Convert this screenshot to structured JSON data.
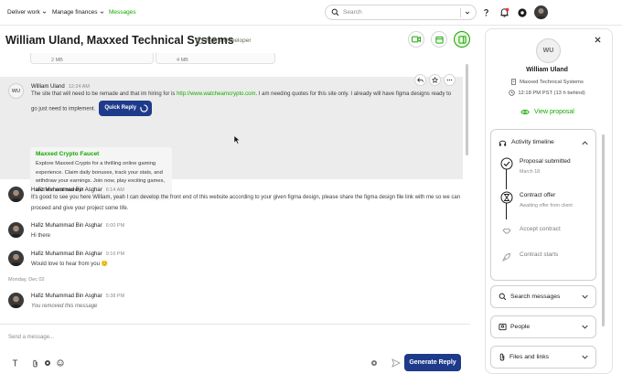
{
  "nav": {
    "items": [
      {
        "label": "Deliver work",
        "has_menu": true
      },
      {
        "label": "Manage finances",
        "has_menu": true
      },
      {
        "label": "Messages",
        "has_menu": false
      }
    ],
    "search_placeholder": "Search",
    "accent": "#14a800"
  },
  "header": {
    "title": "William Uland, Maxxed Technical Systems",
    "subtitle": "Figma Developer"
  },
  "attachments": [
    {
      "size": "2 MB"
    },
    {
      "size": "4 MB"
    }
  ],
  "messages": [
    {
      "avatar_initials": "WU",
      "sender": "William Uland",
      "time": "12:24 AM",
      "text_before": "The site that will need to be remade and that im hiring for is ",
      "link": "http://www.watchearncrypto.com",
      "text_after": ". I am needing quotes for this site only. I already will have figma designs ready to go just need to implement.",
      "quick_reply_label": "Quick Reply",
      "promo": {
        "title": "Maxxed Crypto Faucet",
        "description": "Explore Maxxed Crypto for a thrilling online gaming experience. Claim daily bonuses, track your stats, and withdraw your earnings. Join now, play exciting games, and win real money!"
      }
    },
    {
      "sender": "Hafiz Muhammad Bin Asghar",
      "time": "6:14 AM",
      "text": "It's good to see you here William, yeah I can develop the front end of this website according to your given figma design, please share the figma design file link with me so we can proceed and give your project some life."
    },
    {
      "sender": "Hafiz Muhammad Bin Asghar",
      "time": "6:00 PM",
      "text": "Hi there"
    },
    {
      "sender": "Hafiz Muhammad Bin Asghar",
      "time": "9:16 PM",
      "text": "Would love to hear from you 🙂"
    },
    {
      "divider": "Monday, Dec 02"
    },
    {
      "sender": "Hafiz Muhammad Bin Asghar",
      "time": "5:38 PM",
      "text": "You removed this message"
    }
  ],
  "composer": {
    "placeholder": "Send a message...",
    "generate_label": "Generate Reply",
    "button_color": "#1e3a8a"
  },
  "panel": {
    "avatar_initials": "WU",
    "name": "William Uland",
    "company": "Maxxed Technical Systems",
    "local_time": "12:18 PM PST (13 h behind)",
    "view_proposal_label": "View proposal",
    "timeline": {
      "title": "Activity timeline",
      "steps": [
        {
          "label": "Proposal submitted",
          "sub": "March 18",
          "state": "done"
        },
        {
          "label": "Contract offer",
          "sub": "Awaiting offer from client",
          "state": "current"
        },
        {
          "label": "Accept contract",
          "sub": "",
          "state": "pending"
        },
        {
          "label": "Contract starts",
          "sub": "",
          "state": "pending"
        }
      ]
    },
    "sections": [
      {
        "label": "Search messages"
      },
      {
        "label": "People"
      },
      {
        "label": "Files and links"
      }
    ]
  }
}
